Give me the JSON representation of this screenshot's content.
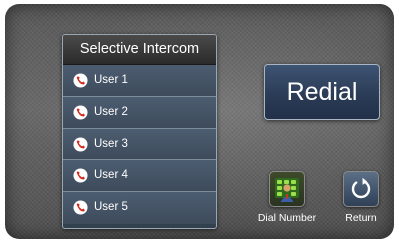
{
  "intercom": {
    "title": "Selective Intercom",
    "users": [
      {
        "label": "User 1"
      },
      {
        "label": "User 2"
      },
      {
        "label": "User 3"
      },
      {
        "label": "User 4"
      },
      {
        "label": "User 5"
      }
    ]
  },
  "actions": {
    "redial_label": "Redial",
    "dial_number_label": "Dial Number",
    "return_label": "Return"
  },
  "icons": {
    "user": "phone-handset-icon",
    "dial_number": "keypad-person-icon",
    "return": "refresh-arrow-icon"
  },
  "colors": {
    "accent_red": "#d6281f",
    "redial_bg": "#2b3c56",
    "panel_bg": "#3f4f62"
  }
}
